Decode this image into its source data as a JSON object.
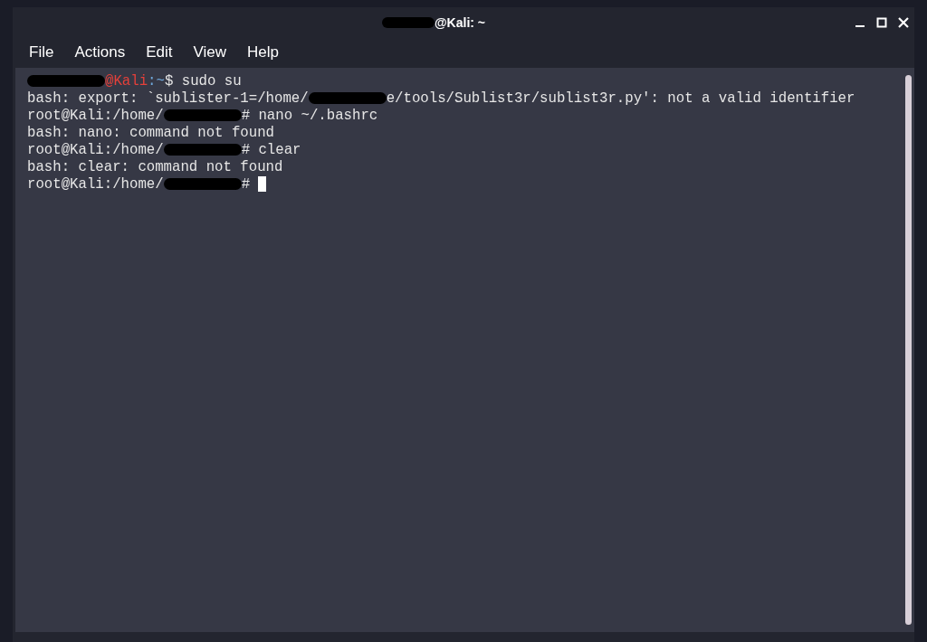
{
  "window": {
    "title": "@Kali: ~",
    "title_redacted": true
  },
  "menu": [
    "File",
    "Actions",
    "Edit",
    "View",
    "Help"
  ],
  "terminal": {
    "lines": [
      [
        {
          "kind": "redacted"
        },
        {
          "kind": "text",
          "text": "@Kali",
          "color": "#e5403a"
        },
        {
          "kind": "text",
          "text": ":~",
          "color": "#6fa8dc"
        },
        {
          "kind": "text",
          "text": "$ sudo su",
          "color": "#e6e6e6"
        }
      ],
      [
        {
          "kind": "text",
          "text": "bash: export: `sublister-1=/home/",
          "color": "#e6e6e6"
        },
        {
          "kind": "redacted"
        },
        {
          "kind": "text",
          "text": "e/tools/Sublist3r/sublist3r.py': not a valid identifier",
          "color": "#e6e6e6"
        }
      ],
      [
        {
          "kind": "text",
          "text": "root@Kali:/home/",
          "color": "#e6e6e6"
        },
        {
          "kind": "redacted"
        },
        {
          "kind": "text",
          "text": "# nano ~/.bashrc",
          "color": "#e6e6e6"
        }
      ],
      [
        {
          "kind": "text",
          "text": "bash: nano: command not found",
          "color": "#e6e6e6"
        }
      ],
      [
        {
          "kind": "text",
          "text": "root@Kali:/home/",
          "color": "#e6e6e6"
        },
        {
          "kind": "redacted"
        },
        {
          "kind": "text",
          "text": "# clear",
          "color": "#e6e6e6"
        }
      ],
      [
        {
          "kind": "text",
          "text": "bash: clear: command not found",
          "color": "#e6e6e6"
        }
      ],
      [
        {
          "kind": "text",
          "text": "root@Kali:/home/",
          "color": "#e6e6e6"
        },
        {
          "kind": "redacted"
        },
        {
          "kind": "text",
          "text": "# ",
          "color": "#e6e6e6"
        },
        {
          "kind": "cursor"
        }
      ]
    ]
  }
}
